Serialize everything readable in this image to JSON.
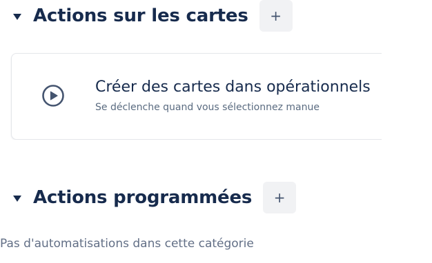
{
  "sections": [
    {
      "title": "Actions sur les cartes",
      "add_label": "+"
    },
    {
      "title": "Actions programmées",
      "add_label": "+"
    }
  ],
  "card": {
    "icon": "play-circle-icon",
    "title": "Créer des cartes dans opérationnels",
    "subtitle": "Se déclenche quand vous sélectionnez manue"
  },
  "empty_state": "Pas d'automatisations dans cette catégorie",
  "colors": {
    "text": "#172b4d",
    "muted": "#626f86",
    "button_bg": "#f1f2f4",
    "card_border": "#e4e6ea"
  }
}
